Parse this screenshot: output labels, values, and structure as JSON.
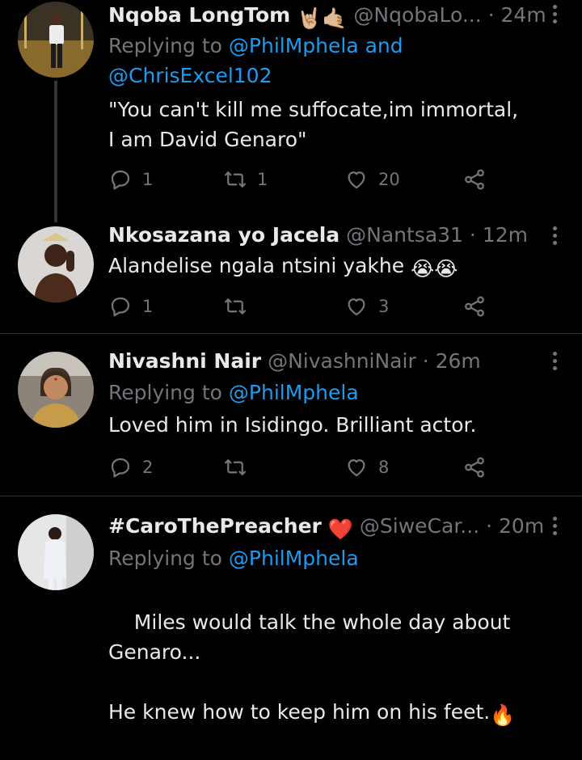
{
  "tweets": [
    {
      "name": "Nqoba LongTom",
      "name_emojis": [
        "🤘🏼",
        "🤙🏼"
      ],
      "handle": "@NqobaLo...",
      "dot": "·",
      "time": "24m",
      "replying_prefix": "Replying to",
      "replying_mention1": "@PhilMphela",
      "replying_and": "and",
      "replying_mention2": "@ChrisExcel102",
      "text": "\"You can't kill me suffocate,im immortal,\nI am David Genaro\"",
      "replies": "1",
      "retweets": "1",
      "likes": "20"
    },
    {
      "name": "Nkosazana yo Jacela",
      "handle": "@Nantsa31",
      "dot": "·",
      "time": "12m",
      "text": "Alandelise ngala ntsini yakhe",
      "text_emojis": "😭😭",
      "replies": "1",
      "retweets": "",
      "likes": "3"
    },
    {
      "name": "Nivashni Nair",
      "handle": "@NivashniNair",
      "dot": "·",
      "time": "26m",
      "replying_prefix": "Replying to",
      "replying_mention1": "@PhilMphela",
      "text": "Loved him in Isidingo. Brilliant actor.",
      "replies": "2",
      "retweets": "",
      "likes": "8"
    },
    {
      "name": "#CaroThePreacher",
      "name_emojis": [
        "❤️"
      ],
      "handle": "@SiweCar...",
      "dot": "·",
      "time": "20m",
      "replying_prefix": "Replying to",
      "replying_mention1": "@PhilMphela",
      "text": "Miles would talk the whole day about\nGenaro...\n\nHe knew how to keep him on his feet.",
      "text_emojis": "🔥"
    }
  ],
  "colors": {
    "background": "#000000",
    "text": "#e7e9ea",
    "muted": "#71767b",
    "link": "#1d9bf0",
    "divider": "#2f3336",
    "heart": "#e0245e"
  },
  "icons": [
    "reply-icon",
    "retweet-icon",
    "like-icon",
    "share-icon",
    "more-icon"
  ]
}
